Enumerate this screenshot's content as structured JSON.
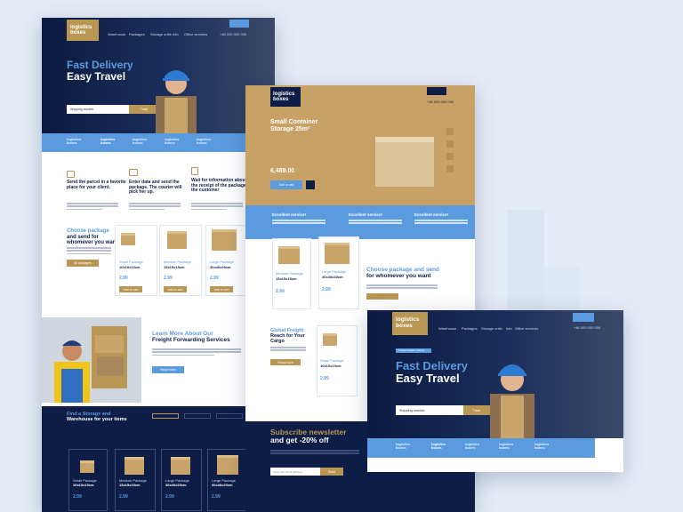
{
  "brand": {
    "logo_line1": "logistics",
    "logo_line2": "boxes",
    "phone": "+46 000 000 000"
  },
  "nav": [
    "Warehouse",
    "Packages",
    "Storage units",
    "Info",
    "Office services"
  ],
  "hero": {
    "title_line1": "Fast Delivery",
    "title_line2": "Easy Travel",
    "badge": "Trusted logistic partner",
    "input_placeholder": "Shipping number",
    "track_label": "Track"
  },
  "strip_items": [
    {
      "a": "logistics",
      "b": "boxes"
    },
    {
      "a": "logistics",
      "b": "boxes"
    },
    {
      "a": "logistics",
      "b": "boxes"
    },
    {
      "a": "logistics",
      "b": "boxes"
    },
    {
      "a": "logistics",
      "b": "boxes"
    }
  ],
  "steps": [
    {
      "title": "Send the parcel in a favorite place for your client.",
      "highlight": ""
    },
    {
      "title": "Enter data and send the package. The courier will pick her up.",
      "highlight": ""
    },
    {
      "title": "Wait for information about the receipt of the package by the customer",
      "highlight": ""
    }
  ],
  "choose": {
    "title_line1": "Choose package",
    "title_line2": "and send for",
    "title_line3": "whomever you want",
    "button": "All packages"
  },
  "packages": [
    {
      "size_name": "Small Package",
      "dims": "10x10x10cm",
      "price": "2.99",
      "button": "Add to cart"
    },
    {
      "size_name": "Medium Package",
      "dims": "15x15x15cm",
      "price": "2.99",
      "button": "Add to cart"
    },
    {
      "size_name": "Large Package",
      "dims": "30x40x20cm",
      "price": "2.99",
      "button": "Add to cart"
    }
  ],
  "learn": {
    "title_line1": "Learn More About Our",
    "title_line2": "Freight Forwarding Services",
    "button": "Read more"
  },
  "storage_find": {
    "title_line1": "Find a Storage and",
    "title_line2": "Warehouse for your items"
  },
  "storage_cards": [
    {
      "size_name": "Small Package",
      "dims": "10x10x10cm",
      "price": "2.99"
    },
    {
      "size_name": "Medium Package",
      "dims": "15x15x15cm",
      "price": "2.99"
    },
    {
      "size_name": "Large Package",
      "dims": "30x40x20cm",
      "price": "2.99"
    },
    {
      "size_name": "Large Package",
      "dims": "30x40x20cm",
      "price": "2.99"
    }
  ],
  "product": {
    "title_line1": "Small Container",
    "title_line2": "Storage 25m²",
    "price": "6,489.00",
    "add_label": "Add to cart",
    "phone": "+46 000 000 000"
  },
  "service_items": [
    "Excellent service!",
    "Excellent service!",
    "Excellent service!"
  ],
  "shop2": {
    "choose_line1": "Choose package and send",
    "choose_line2": "for whomever you want",
    "global_line1": "Global Freight",
    "global_line2": "Reach for Your",
    "global_line3": "Cargo",
    "global_btn": "Read more",
    "pkg": [
      {
        "size_name": "Medium Package",
        "dims": "15x15x15cm",
        "price": "2.99"
      },
      {
        "size_name": "Large Package",
        "dims": "30x40x20cm",
        "price": "2.99"
      },
      {
        "size_name": "Small Package",
        "dims": "10x10x10cm",
        "price": "2.99"
      }
    ]
  },
  "newsletter": {
    "title_line1": "Subscribe newsletter",
    "title_line2": "and get -20% off",
    "placeholder": "Type your email address",
    "button": "Send"
  },
  "colors": {
    "navy": "#0d1d45",
    "gold": "#b99654",
    "blue": "#5a9be0",
    "background": "#e6ecf6"
  }
}
